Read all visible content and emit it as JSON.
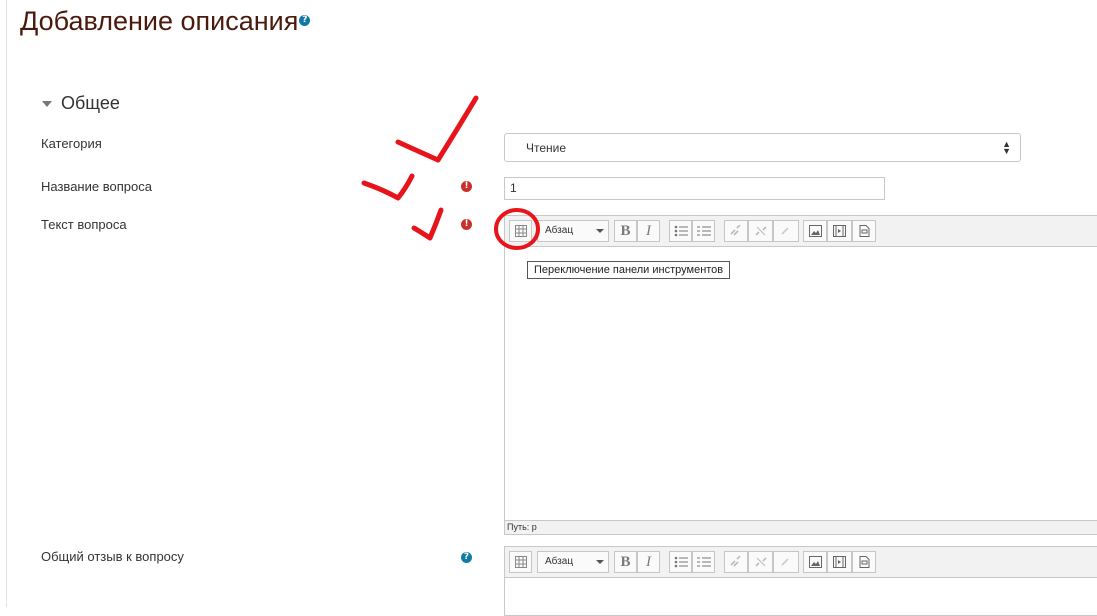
{
  "page": {
    "title": "Добавление описания",
    "help_icon": "?"
  },
  "section": {
    "title": "Общее",
    "state": "expanded"
  },
  "form": {
    "category": {
      "label": "Категория",
      "value": "Чтение"
    },
    "question_name": {
      "label": "Название вопроса",
      "value": "1",
      "required": true
    },
    "question_text": {
      "label": "Текст вопроса",
      "required": true,
      "format_label": "Абзац",
      "tooltip": "Переключение панели инструментов",
      "status": "Путь: p"
    },
    "general_feedback": {
      "label": "Общий отзыв к вопросу",
      "format_label": "Абзац"
    }
  },
  "toolbar_icons": [
    "toolbar-toggle-icon",
    "bold-icon",
    "italic-icon",
    "unordered-list-icon",
    "ordered-list-icon",
    "link-icon",
    "unlink-icon",
    "anchor-icon",
    "image-icon",
    "media-icon",
    "file-icon"
  ],
  "toolbar_glyphs": {
    "bold": "B",
    "italic": "I"
  },
  "colors": {
    "title": "#4a1a0c",
    "required": "#c9302c",
    "help": "#0f7fa0",
    "annotation": "#e8141b"
  }
}
